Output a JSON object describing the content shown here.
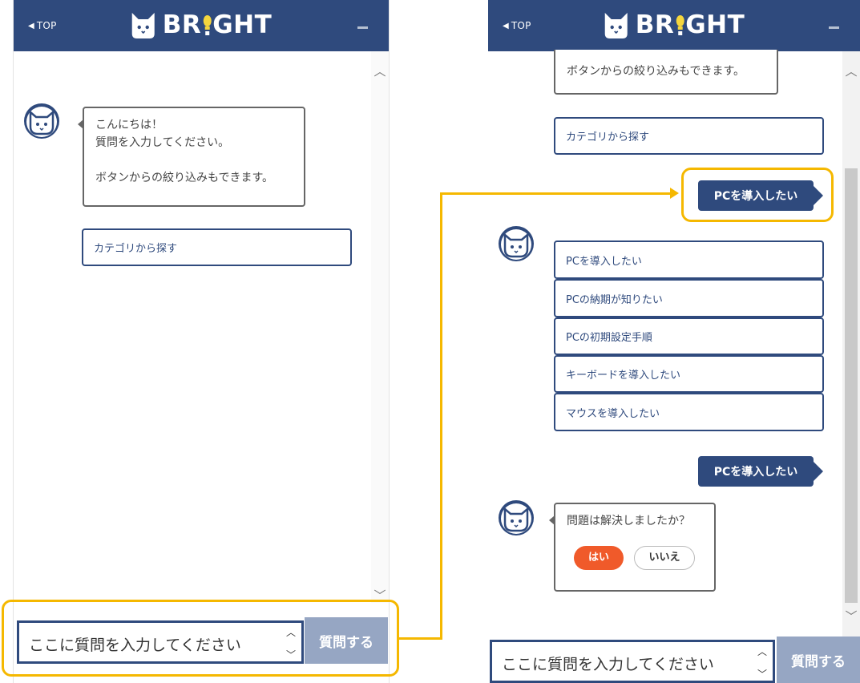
{
  "header": {
    "top_label": "TOP",
    "logo_prefix": "BR",
    "logo_suffix": "GHT",
    "accent_color": "#2f4a7d"
  },
  "left_panel": {
    "greeting_lines": [
      "こんにちは！",
      "質問を入力してください。",
      "",
      "ボタンからの絞り込みもできます。"
    ],
    "category_button": "カテゴリから探す",
    "input_placeholder": "ここに質問を入力してください",
    "submit_label": "質問する"
  },
  "right_panel": {
    "greeting_tail": "ボタンからの絞り込みもできます。",
    "category_button": "カテゴリから探す",
    "user_message_1": "PCを導入したい",
    "options": [
      "PCを導入したい",
      "PCの納期が知りたい",
      "PCの初期設定手順",
      "キーボードを導入したい",
      "マウスを導入したい"
    ],
    "user_message_2": "PCを導入したい",
    "resolved_question": "問題は解決しましたか？",
    "yes_label": "はい",
    "no_label": "いいえ",
    "input_placeholder": "ここに質問を入力してください",
    "submit_label": "質問する"
  },
  "highlight_color": "#f5b800"
}
